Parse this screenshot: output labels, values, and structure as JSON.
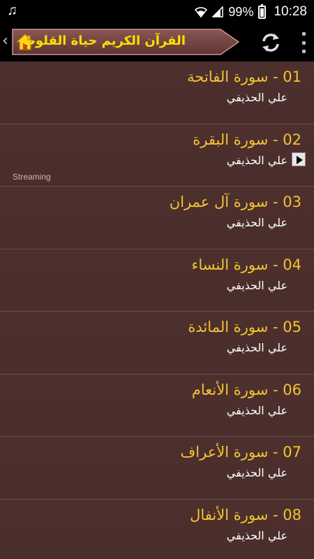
{
  "status_bar": {
    "battery_text": "99%",
    "time": "10:28",
    "music_icon": "music-note-icon"
  },
  "app_bar": {
    "title": "القرآن الكريم  حياة القلوب",
    "accent_color": "#ffe000"
  },
  "list": {
    "items": [
      {
        "title": "01 - سورة الفاتحة",
        "reciter": "علي الحذيفي"
      },
      {
        "title": "02 - سورة البقرة",
        "reciter": "علي الحذيفي",
        "status": "Streaming"
      },
      {
        "title": "03 - سورة آل عمران",
        "reciter": "علي الحذيفي"
      },
      {
        "title": "04 - سورة النساء",
        "reciter": "علي الحذيفي"
      },
      {
        "title": "05 - سورة المائدة",
        "reciter": "علي الحذيفي"
      },
      {
        "title": "06 - سورة الأنعام",
        "reciter": "علي الحذيفي"
      },
      {
        "title": "07 - سورة الأعراف",
        "reciter": "علي الحذيفي"
      },
      {
        "title": "08 - سورة الأنفال",
        "reciter": "علي الحذيفي"
      }
    ],
    "title_color": "#f4c431"
  }
}
